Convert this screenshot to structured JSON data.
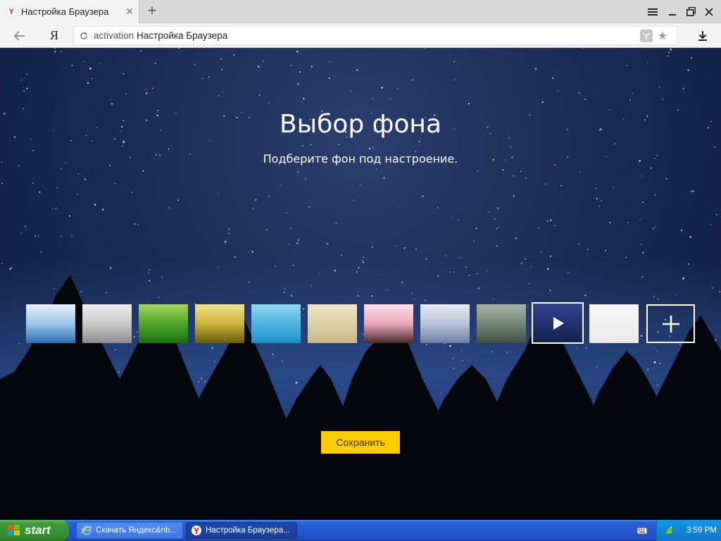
{
  "browser": {
    "tab": {
      "title": "Настройка Браузера",
      "favicon": "Y"
    },
    "address": {
      "url": "activation",
      "page_title": "Настройка Браузера",
      "yandex_button": "Я"
    }
  },
  "page": {
    "title": "Выбор фона",
    "subtitle": "Подберите фон под настроение.",
    "save_button": "Сохранить",
    "backgrounds": [
      {
        "name": "sky-clouds",
        "colors": [
          "#2b6fb2",
          "#9cc6ea",
          "#e8f1f7"
        ]
      },
      {
        "name": "fog",
        "colors": [
          "#8e8e8e",
          "#c9c9c9",
          "#efefef"
        ]
      },
      {
        "name": "green-grass",
        "colors": [
          "#1d6e12",
          "#4fa62b",
          "#a5d65b"
        ]
      },
      {
        "name": "golden-field",
        "colors": [
          "#6b5c10",
          "#c9b23a",
          "#f3e48c"
        ]
      },
      {
        "name": "turquoise-water",
        "colors": [
          "#1f90c8",
          "#4fb6e2",
          "#8fd6f2"
        ]
      },
      {
        "name": "sand",
        "colors": [
          "#c7b88a",
          "#ddd0a6",
          "#eee6c6"
        ]
      },
      {
        "name": "cherry-blossom",
        "colors": [
          "#4a2a2a",
          "#e8a6b8",
          "#fbe3ea"
        ]
      },
      {
        "name": "mountains",
        "colors": [
          "#6e7fa6",
          "#b8c3d9",
          "#e8ecf3"
        ]
      },
      {
        "name": "rain-glass",
        "colors": [
          "#3f5043",
          "#74877a",
          "#a7b3a9"
        ]
      },
      {
        "name": "night-video",
        "colors": [
          "#13224a",
          "#1f3070",
          "#30448c"
        ]
      },
      {
        "name": "white-blank",
        "colors": [
          "#e9e9e9",
          "#f1f1f1",
          "#f7f7f7"
        ]
      }
    ],
    "selected_background_index": 9
  },
  "taskbar": {
    "start_label": "start",
    "items": [
      {
        "label": "Скачать Яндекс&nb..."
      },
      {
        "label": "Настройка Браузера..."
      }
    ],
    "clock": "3:59 PM"
  }
}
